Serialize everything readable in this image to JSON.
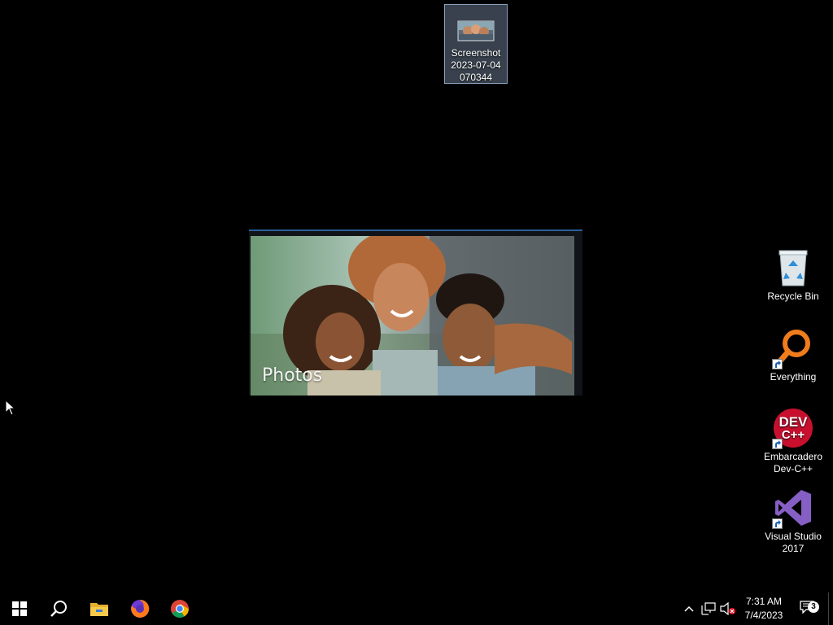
{
  "desktop": {
    "icons": {
      "screenshot": {
        "line1": "Screenshot",
        "line2": "2023-07-04",
        "line3": "070344"
      },
      "recycle_bin": {
        "label": "Recycle Bin"
      },
      "everything": {
        "label": "Everything"
      },
      "devcpp": {
        "line1": "Embarcadero",
        "line2": "Dev-C++",
        "logo_line1": "DEV",
        "logo_line2": "C++"
      },
      "visual_studio": {
        "line1": "Visual Studio",
        "line2": "2017"
      }
    }
  },
  "photos_window": {
    "title": "Photos"
  },
  "taskbar": {
    "pinned": [
      "start-icon",
      "search-icon",
      "file-explorer-icon",
      "firefox-icon",
      "chrome-icon"
    ],
    "clock": {
      "time": "7:31 AM",
      "date": "7/4/2023"
    },
    "notifications_count": "3"
  },
  "colors": {
    "desktop_bg": "#000000",
    "taskbar_bg": "#000000",
    "selection": "#66778c",
    "devcpp_red": "#c8102e",
    "vs_purple": "#865fc5",
    "everything_orange": "#f07c1b"
  }
}
